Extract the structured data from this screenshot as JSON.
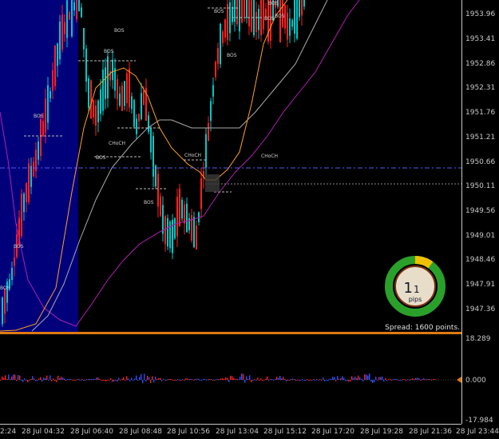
{
  "chart_data": {
    "type": "candlestick",
    "price_ticks": [
      "1953.96",
      "1953.41",
      "1952.86",
      "1952.31",
      "1951.76",
      "1951.21",
      "1950.66",
      "1950.11",
      "1949.56",
      "1949.01",
      "1948.46",
      "1947.91",
      "1947.36"
    ],
    "current_price": "1950.61",
    "time_ticks": [
      "2:24",
      "28 Jul 04:32",
      "28 Jul 06:40",
      "28 Jul 08:48",
      "28 Jul 10:56",
      "28 Jul 13:04",
      "28 Jul 15:12",
      "28 Jul 17:20",
      "28 Jul 19:28",
      "28 Jul 21:36",
      "28 Jul 23:44"
    ],
    "indicator_ticks": [
      "18.289",
      "0.000",
      "-17.984"
    ],
    "structure_labels": [
      {
        "text": "BOS",
        "color": "#ff3030"
      },
      {
        "text": "BOS",
        "color": "#d0d0d0"
      },
      {
        "text": "BOS",
        "color": "#d0d0d0"
      },
      {
        "text": "BOS",
        "color": "#d0d0d0"
      },
      {
        "text": "BOS",
        "color": "#d0d0d0"
      },
      {
        "text": "BOS",
        "color": "#d0d0d0"
      },
      {
        "text": "BOS",
        "color": "#d0d0d0"
      },
      {
        "text": "CHoCH",
        "color": "#d0d0d0"
      },
      {
        "text": "CHoCH",
        "color": "#d0d0d0"
      },
      {
        "text": "BOS",
        "color": "#ff3030"
      },
      {
        "text": "BOS",
        "color": "#d0d0d0"
      },
      {
        "text": "BOS",
        "color": "#8070ff"
      },
      {
        "text": "BOS",
        "color": "#8070ff"
      },
      {
        "text": "CHoCH",
        "color": "#d0d0d0"
      },
      {
        "text": "BOS",
        "color": "#d0d0d0"
      }
    ],
    "spread_gauge": {
      "value_main": "1",
      "value_decimal": "1",
      "unit": "pips",
      "level": 0.1
    },
    "spread_text": "Spread: 1600 points.",
    "colors": {
      "bull": "#00c8c8",
      "bear": "#ff2020",
      "ma_fast": "#ffa020",
      "ma_mid": "#aaaaaa",
      "ma_slow": "#b020b0",
      "highlight": "#00007a",
      "accent": "#e07a10"
    }
  }
}
